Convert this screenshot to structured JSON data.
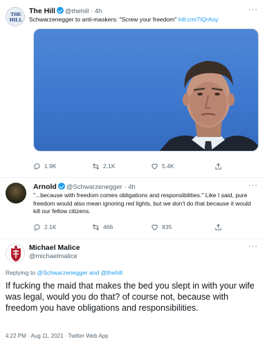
{
  "tweet1": {
    "avatar_text": "THE HILL",
    "name": "The Hill",
    "handle": "@thehill · 4h",
    "text": "Schwarzenegger to anti-maskers: \"Screw your freedom\" ",
    "link": "hill.cm/7lQrAoy",
    "replies": "1.9K",
    "retweets": "2.1K",
    "likes": "5.4K"
  },
  "tweet2": {
    "name": "Arnold",
    "handle": "@Schwarzenegger · 4h",
    "text": "\"...because with freedom comes obligations and responsibilities.\" Like I said, pure freedom would also mean ignoring red lights, but we don't do that because it would kill our fellow citizens.",
    "replies": "2.1K",
    "retweets": "466",
    "likes": "835"
  },
  "tweet3": {
    "name": "Michael Malice",
    "handle": "@michaelmalice",
    "replying_prefix": "Replying to ",
    "replying_targets": "@Schwarzenegger and @thehill",
    "text": "If fucking the maid that makes the bed you slept in with your wife was legal, would you do that? of course not, because with freedom you have obligations and responsibilities.",
    "timestamp": "4:22 PM · Aug 11, 2021 · Twitter Web App"
  },
  "more_label": "···",
  "colors": {
    "accent": "#1d9bf0",
    "text": "#0f1419",
    "muted": "#536471",
    "photo_bg": "#3e79d0"
  }
}
